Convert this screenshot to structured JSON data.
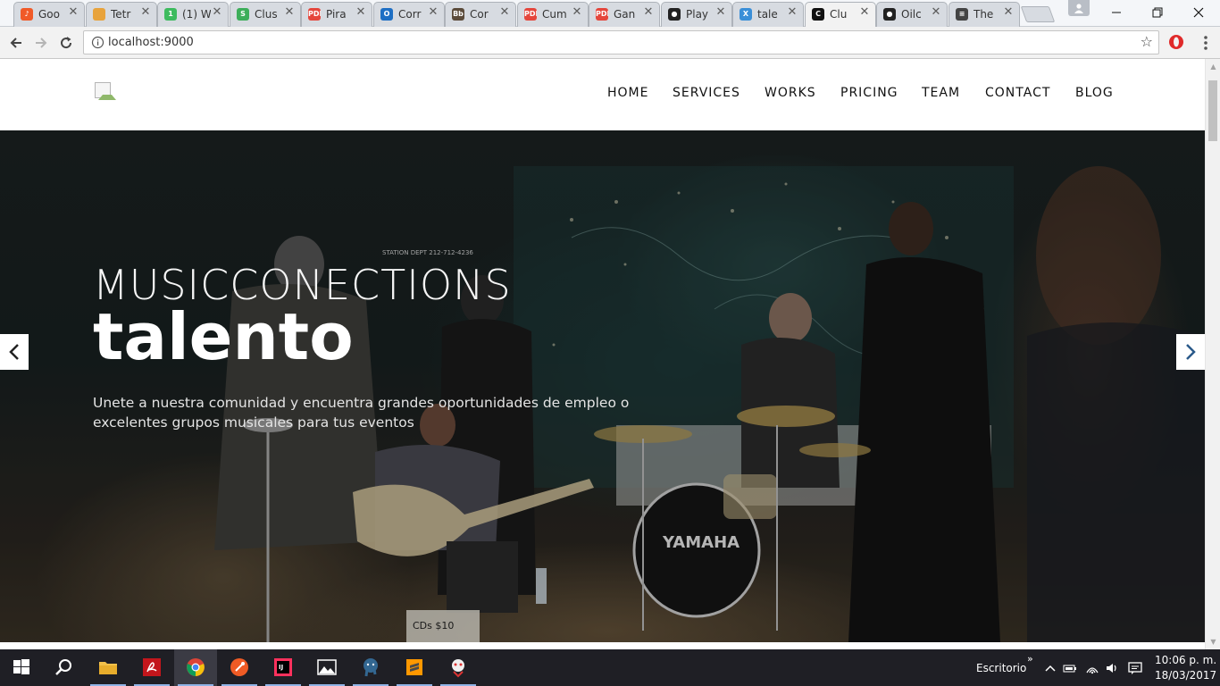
{
  "browser": {
    "tabs": [
      {
        "title": "Goo",
        "favicon": "bolt-icon",
        "color": "#f05a28",
        "glyph": "♪"
      },
      {
        "title": "Tetr",
        "favicon": "slides-icon",
        "color": "#e8a33c",
        "glyph": ""
      },
      {
        "title": "(1) W",
        "favicon": "whatsapp-icon",
        "color": "#3dbb5e",
        "glyph": "1"
      },
      {
        "title": "Clus",
        "favicon": "spiral-icon",
        "color": "#3dae5a",
        "glyph": "S"
      },
      {
        "title": "Pira",
        "favicon": "pdf-icon",
        "color": "#e5463c",
        "glyph": "PDF"
      },
      {
        "title": "Corr",
        "favicon": "outlook-icon",
        "color": "#1e6fc4",
        "glyph": "O"
      },
      {
        "title": "Cor",
        "favicon": "blackboard-icon",
        "color": "#5b4b3a",
        "glyph": "Bb"
      },
      {
        "title": "Cum",
        "favicon": "pdf-icon",
        "color": "#e5463c",
        "glyph": "PDF"
      },
      {
        "title": "Gan",
        "favicon": "pdf-icon",
        "color": "#e5463c",
        "glyph": "PDF"
      },
      {
        "title": "Play",
        "favicon": "github-icon",
        "color": "#222222",
        "glyph": "●"
      },
      {
        "title": "tale",
        "favicon": "x-icon",
        "color": "#3a8fd8",
        "glyph": "X"
      },
      {
        "title": "Clu",
        "favicon": "c-icon",
        "color": "#111111",
        "glyph": "C"
      },
      {
        "title": "Oilc",
        "favicon": "github-icon",
        "color": "#222222",
        "glyph": "●"
      },
      {
        "title": "The",
        "favicon": "doc-icon",
        "color": "#444444",
        "glyph": "≡"
      }
    ],
    "close_glyph": "✕",
    "url": "localhost:9000"
  },
  "site": {
    "nav": [
      "HOME",
      "SERVICES",
      "WORKS",
      "PRICING",
      "TEAM",
      "CONTACT",
      "BLOG"
    ],
    "hero": {
      "kicker": "MUSICCONECTIONS",
      "title": "talento",
      "subtitle": "Unete a nuestra comunidad y encuentra grandes oportunidades de empleo o excelentes grupos musicales para tus eventos",
      "photo_text": {
        "station": "STATION DEPT 212-712-4236",
        "drum_brand": "YAMAHA",
        "sign": "CDs $10"
      }
    }
  },
  "taskbar": {
    "apps": [
      "windows-start-icon",
      "search-icon",
      "file-explorer-icon",
      "acrobat-icon",
      "chrome-icon",
      "postman-icon",
      "intellij-icon",
      "photos-icon",
      "postgres-icon",
      "sublime-icon",
      "robot-app-icon"
    ],
    "desktop_label": "Escritorio",
    "time": "10:06 p. m.",
    "date": "18/03/2017"
  },
  "colors": {
    "accent": "#8fb3e6",
    "taskbar": "#1f1f25",
    "tab_active": "#f2f2f2"
  }
}
